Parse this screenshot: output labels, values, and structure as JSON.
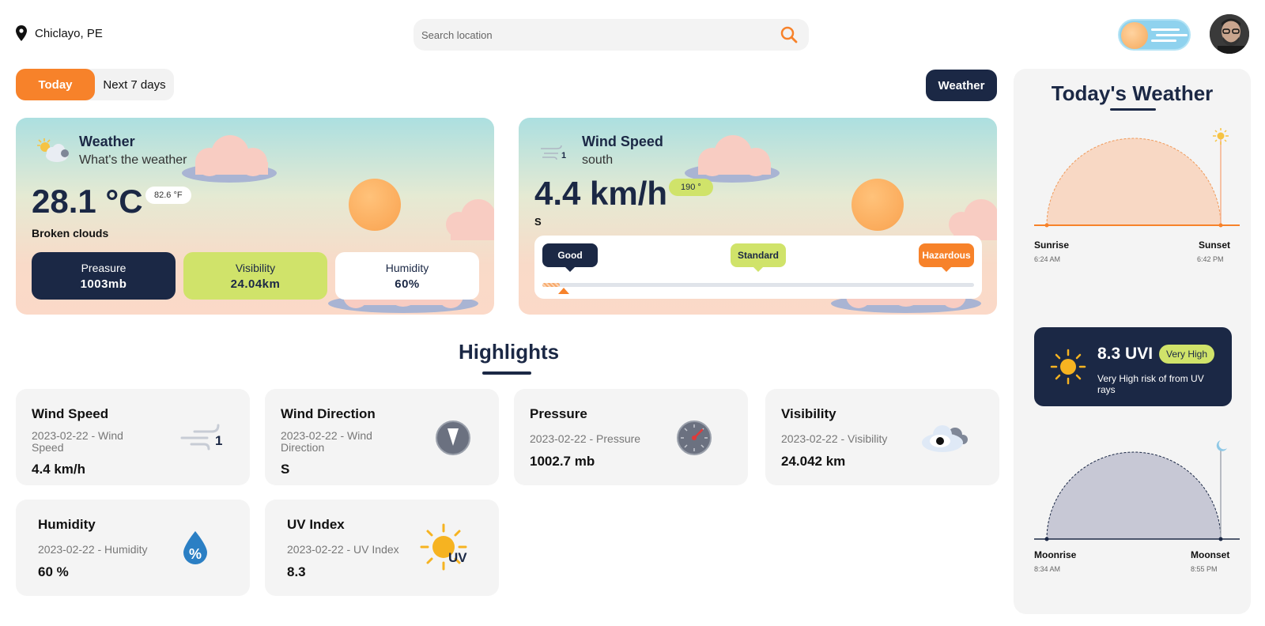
{
  "header": {
    "location": "Chiclayo, PE",
    "search_placeholder": "Search location"
  },
  "tabs": {
    "today": "Today",
    "next7": "Next 7 days"
  },
  "weather_button": "Weather",
  "weather_card": {
    "title": "Weather",
    "subtitle": "What's the weather",
    "temp_c": "28.1 °C",
    "temp_f": "82.6 °F",
    "condition": "Broken clouds",
    "stats": [
      {
        "label": "Preasure",
        "value": "1003mb"
      },
      {
        "label": "Visibility",
        "value": "24.04km"
      },
      {
        "label": "Humidity",
        "value": "60%"
      }
    ]
  },
  "wind_card": {
    "title": "Wind Speed",
    "subtitle": "south",
    "icon_number": "1",
    "speed": "4.4 km/h",
    "degrees": "190 °",
    "direction": "S",
    "scale": {
      "good": "Good",
      "standard": "Standard",
      "hazardous": "Hazardous"
    },
    "level_fraction": 0.04
  },
  "highlights": {
    "title": "Highlights",
    "cards": [
      {
        "title": "Wind Speed",
        "date": "2023-02-22 - Wind Speed",
        "value": "4.4 km/h",
        "icon_text": "1"
      },
      {
        "title": "Wind Direction",
        "date": "2023-02-22 - Wind Direction",
        "value": "S"
      },
      {
        "title": "Pressure",
        "date": "2023-02-22 - Pressure",
        "value": "1002.7 mb"
      },
      {
        "title": "Visibility",
        "date": "2023-02-22 - Visibility",
        "value": "24.042 km"
      },
      {
        "title": "Humidity",
        "date": "2023-02-22 - Humidity",
        "value": "60 %",
        "icon_text": "%"
      },
      {
        "title": "UV Index",
        "date": "2023-02-22 - UV Index",
        "value": "8.3",
        "icon_text": "UV"
      }
    ]
  },
  "today_panel": {
    "title": "Today's Weather",
    "sunrise_label": "Sunrise",
    "sunrise_time": "6:24 AM",
    "sunset_label": "Sunset",
    "sunset_time": "6:42 PM",
    "uvi_value": "8.3 UVI",
    "uvi_badge": "Very High",
    "uvi_desc": "Very High risk of from UV rays",
    "moonrise_label": "Moonrise",
    "moonrise_time": "8:34 AM",
    "moonset_label": "Moonset",
    "moonset_time": "8:55 PM"
  },
  "colors": {
    "accent_orange": "#f7822a",
    "navy": "#1b2845",
    "lime": "#d0e36a"
  }
}
